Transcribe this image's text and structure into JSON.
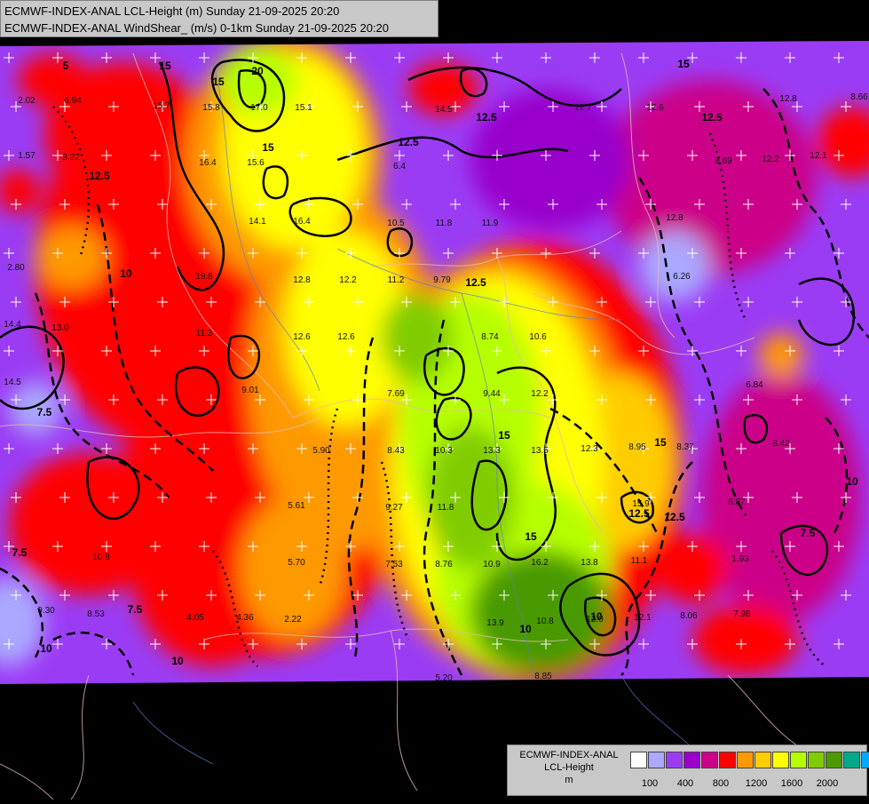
{
  "title": {
    "line1": "ECMWF-INDEX-ANAL LCL-Height (m) Sunday 21-09-2025 20:20",
    "line2": "ECMWF-INDEX-ANAL WindShear_ (m/s) 0-1km Sunday 21-09-2025 20:20"
  },
  "legend": {
    "line1": "ECMWF-INDEX-ANAL",
    "line2": "LCL-Height",
    "unit": "m",
    "colors": [
      "#ffffff",
      "#aaa8ff",
      "#9b3cf5",
      "#9900cc",
      "#cc0088",
      "#ff0000",
      "#ff9900",
      "#ffcc00",
      "#ffff00",
      "#b6ff00",
      "#80cc00",
      "#4a9a00",
      "#00aa88",
      "#00aaff"
    ],
    "ticks": [
      "100",
      "400",
      "800",
      "1200",
      "1600",
      "2000"
    ]
  },
  "point_values": [
    {
      "v": "2.02"
    },
    {
      "v": "6.94"
    },
    {
      "v": "15.7"
    },
    {
      "v": "15.8"
    },
    {
      "v": "17.0"
    },
    {
      "v": "15.1"
    },
    {
      "v": "14.5"
    },
    {
      "v": "12.7"
    },
    {
      "v": "12.6"
    },
    {
      "v": "12.8"
    },
    {
      "v": "8.66"
    },
    {
      "v": "1.57"
    },
    {
      "v": "3.27"
    },
    {
      "v": "16.4"
    },
    {
      "v": "15.6"
    },
    {
      "v": "6.4"
    },
    {
      "v": "8.69"
    },
    {
      "v": "12.2"
    },
    {
      "v": "12.1"
    },
    {
      "v": "14.1"
    },
    {
      "v": "16.4"
    },
    {
      "v": "10.5"
    },
    {
      "v": "11.8"
    },
    {
      "v": "11.9"
    },
    {
      "v": "12.8"
    },
    {
      "v": "2.80"
    },
    {
      "v": "19.8"
    },
    {
      "v": "12.8"
    },
    {
      "v": "12.2"
    },
    {
      "v": "11.2"
    },
    {
      "v": "9.79"
    },
    {
      "v": "6.26"
    },
    {
      "v": "14.4"
    },
    {
      "v": "13.0"
    },
    {
      "v": "11.3"
    },
    {
      "v": "12.6"
    },
    {
      "v": "12.6"
    },
    {
      "v": "8.74"
    },
    {
      "v": "10.6"
    },
    {
      "v": "14.5"
    },
    {
      "v": "9.01"
    },
    {
      "v": "7.69"
    },
    {
      "v": "9.44"
    },
    {
      "v": "12.2"
    },
    {
      "v": "6.84"
    },
    {
      "v": "5.90"
    },
    {
      "v": "8.43"
    },
    {
      "v": "10.3"
    },
    {
      "v": "13.3"
    },
    {
      "v": "13.5"
    },
    {
      "v": "12.3"
    },
    {
      "v": "8.95"
    },
    {
      "v": "8.37"
    },
    {
      "v": "8.42"
    },
    {
      "v": "5.61"
    },
    {
      "v": "9.27"
    },
    {
      "v": "11.8"
    },
    {
      "v": "15.9"
    },
    {
      "v": "8.87"
    },
    {
      "v": "10.8"
    },
    {
      "v": "5.70"
    },
    {
      "v": "7.53"
    },
    {
      "v": "8.76"
    },
    {
      "v": "10.9"
    },
    {
      "v": "16.2"
    },
    {
      "v": "13.8"
    },
    {
      "v": "11.1"
    },
    {
      "v": "1.93"
    },
    {
      "v": "9.30"
    },
    {
      "v": "8.53"
    },
    {
      "v": "4.05"
    },
    {
      "v": "4.36"
    },
    {
      "v": "2.22"
    },
    {
      "v": "13.9"
    },
    {
      "v": "10.8"
    },
    {
      "v": "12.0"
    },
    {
      "v": "12.1"
    },
    {
      "v": "8.06"
    },
    {
      "v": "7.98"
    },
    {
      "v": "8.85"
    },
    {
      "v": "5.20"
    }
  ],
  "contour_labels": [
    "15",
    "15",
    "20",
    "15",
    "12.5",
    "12.5",
    "15",
    "12.5",
    "12.5",
    "10",
    "7.5",
    "7.5",
    "10",
    "12.5",
    "15",
    "12.5",
    "15",
    "10",
    "10",
    "12.5",
    "15",
    "7.5",
    "10",
    "10",
    "7.5",
    "5"
  ]
}
